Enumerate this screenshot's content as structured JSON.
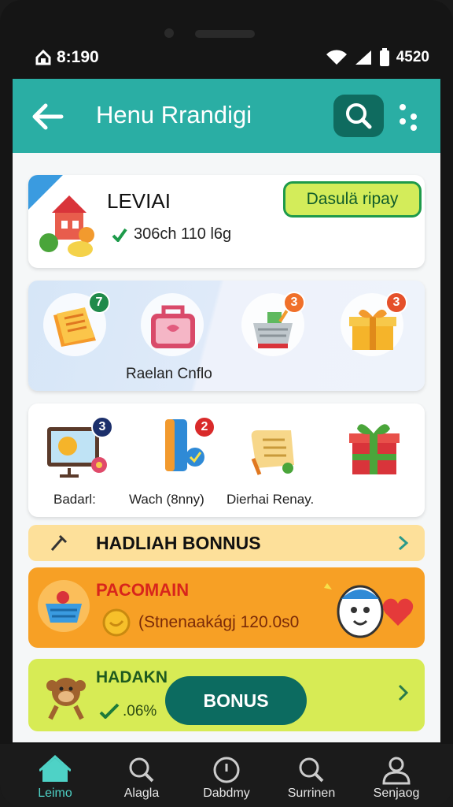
{
  "status_bar": {
    "time": "8:190",
    "battery": "4520"
  },
  "app_bar": {
    "title": "Henu Rrandigi"
  },
  "profile_card": {
    "title": "LEVIAI",
    "subtitle": "306ch 110 l6g",
    "action_button": "Dasulä ripay"
  },
  "category_card": {
    "label": "Raelan Cnflo",
    "items": [
      {
        "icon": "document-icon",
        "badge": "7"
      },
      {
        "icon": "briefcase-icon",
        "badge": ""
      },
      {
        "icon": "basket-icon",
        "badge": "3"
      },
      {
        "icon": "gift-box-icon",
        "badge": "3"
      }
    ]
  },
  "feature_card": {
    "items": [
      {
        "label": "Badarl:",
        "icon": "monitor-icon",
        "badge": "3"
      },
      {
        "label": "Wach (8nny)",
        "icon": "phone-check-icon",
        "badge": "2"
      },
      {
        "label": "Dierhai Renay.",
        "icon": "scroll-icon",
        "badge": ""
      },
      {
        "label": "",
        "icon": "present-icon",
        "badge": ""
      }
    ]
  },
  "banner_bonus": {
    "title": "HADLIAH BONNUS"
  },
  "banner_promo": {
    "title": "PACOMAIN",
    "subtitle": "(Stnenaakágj 120.0s0"
  },
  "banner_green": {
    "title": "HADAKN",
    "subtitle": ".06%",
    "button": "BONUS"
  },
  "bottom_nav": {
    "items": [
      {
        "label": "Leimo",
        "icon": "home-icon",
        "active": true
      },
      {
        "label": "Alagla",
        "icon": "search-icon",
        "active": false
      },
      {
        "label": "Dabdmy",
        "icon": "clock-icon",
        "active": false
      },
      {
        "label": "Surrinen",
        "icon": "search-icon",
        "active": false
      },
      {
        "label": "Senjaog",
        "icon": "person-icon",
        "active": false
      }
    ]
  },
  "colors": {
    "primary": "#2aaea4",
    "dark_teal": "#0c6b60",
    "orange": "#f7a025",
    "lime": "#d7eb55",
    "yellow_banner": "#fde09a"
  }
}
